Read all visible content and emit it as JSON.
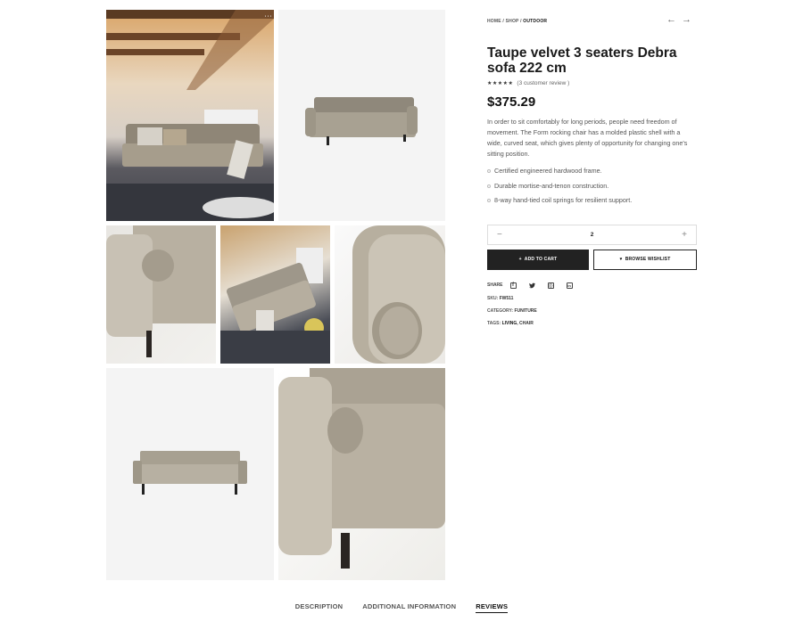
{
  "breadcrumb": {
    "home": "HOME",
    "shop": "SHOP",
    "current": "OUTDOOR"
  },
  "nav": {
    "prev": "←",
    "next": "→"
  },
  "product": {
    "title": "Taupe velvet 3 seaters Debra sofa 222 cm",
    "stars": "★★★★★",
    "review_text": "(3 customer review )",
    "price": "$375.29",
    "description": "In order to sit comfortably for long periods, people need freedom of movement. The Form rocking chair has a molded plastic shell with a wide, curved seat, which gives plenty of opportunity for changing one's sitting position.",
    "features": [
      "Certified engineered hardwood frame.",
      "Durable mortise-and-tenon construction.",
      "8-way hand-tied coil springs for resilient support."
    ]
  },
  "quantity": {
    "minus": "−",
    "value": "2",
    "plus": "+"
  },
  "actions": {
    "cart_icon": "+",
    "cart_label": "ADD TO CART",
    "wishlist_icon": "♥",
    "wishlist_label": "BROWSE WISHLIST"
  },
  "share": {
    "label": "SHARE",
    "icons": [
      "facebook-icon",
      "twitter-icon",
      "instagram-icon",
      "linkedin-icon"
    ],
    "facebook": "f",
    "twitter": "🐦",
    "instagram": "◎",
    "linkedin": "in"
  },
  "meta": {
    "sku_label": "SKU:",
    "sku": "FW511",
    "category_label": "CATEGORY:",
    "category": "FUNITURE",
    "tags_label": "TAGS:",
    "tag1": "LIVING,",
    "tag2": "CHAIR"
  },
  "tabs": [
    "DESCRIPTION",
    "ADDITIONAL INFORMATION",
    "REVIEWS"
  ],
  "active_tab": "REVIEWS",
  "colors": {
    "accent": "#222222",
    "sofa": "#a8a192",
    "background": "#f4f4f4"
  }
}
